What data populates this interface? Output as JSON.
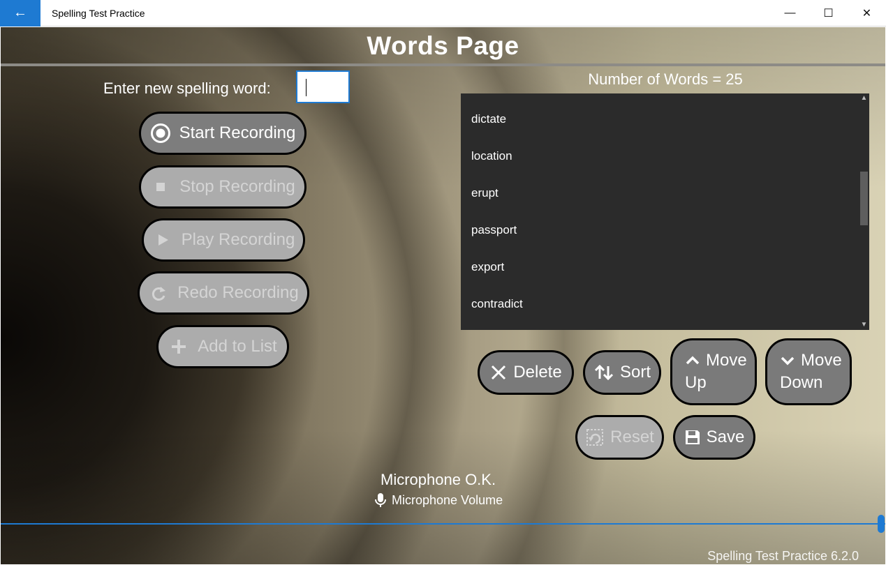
{
  "window": {
    "title": "Spelling Test Practice",
    "back_icon": "←",
    "minimize_icon": "—",
    "maximize_icon": "☐",
    "close_icon": "✕"
  },
  "page": {
    "title": "Words Page"
  },
  "entry": {
    "label": "Enter new spelling word:",
    "value": ""
  },
  "recording": {
    "start": "Start Recording",
    "stop": "Stop Recording",
    "play": "Play Recording",
    "redo": "Redo Recording",
    "add": "Add to List"
  },
  "word_list": {
    "count_text": "Number of Words = 25",
    "items": [
      "dictate",
      "location",
      "erupt",
      "passport",
      "export",
      "contradict"
    ],
    "scroll_fraction": 0.42
  },
  "actions": {
    "delete": "Delete",
    "sort": "Sort",
    "move_up_1": "Move",
    "move_up_2": "Up",
    "move_down_1": "Move",
    "move_down_2": "Down",
    "reset": "Reset",
    "save": "Save"
  },
  "microphone": {
    "status": "Microphone O.K.",
    "volume_label": "Microphone Volume",
    "volume_level": 1.0
  },
  "footer": {
    "version": "Spelling Test Practice 6.2.0"
  },
  "colors": {
    "accent": "#1e7ad2",
    "button_active": "#7a7a7a",
    "button_disabled": "#acacac",
    "list_bg": "#2b2b2b"
  }
}
